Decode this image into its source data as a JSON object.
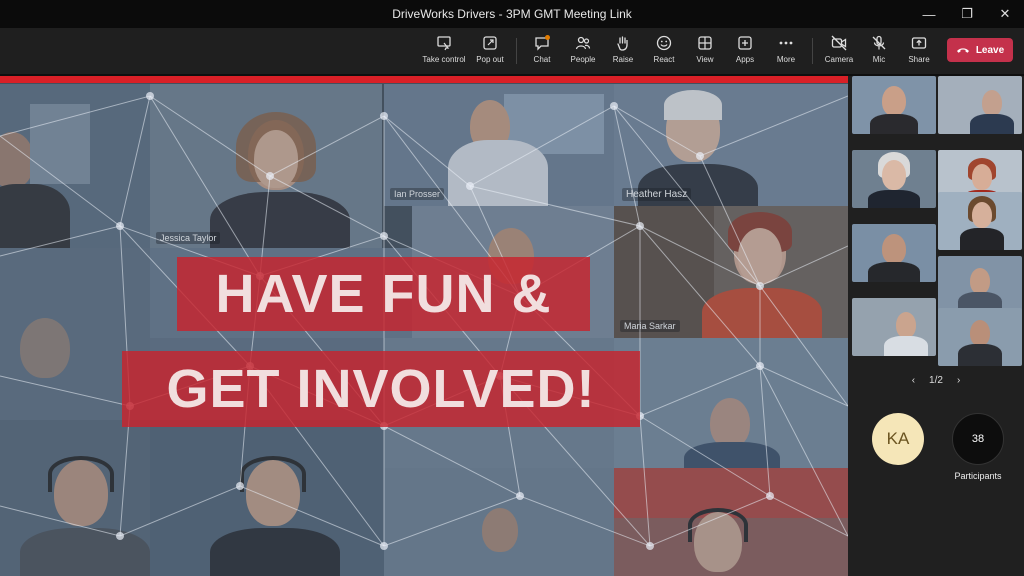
{
  "window": {
    "title": "DriveWorks Drivers - 3PM GMT Meeting Link",
    "controls": [
      "minimize-icon",
      "restore-icon",
      "close-icon"
    ]
  },
  "toolbar": {
    "items": [
      {
        "label": "Take control",
        "icon": "take-control-icon"
      },
      {
        "label": "Pop out",
        "icon": "pop-out-icon"
      },
      {
        "label": "Chat",
        "icon": "chat-icon"
      },
      {
        "label": "People",
        "icon": "people-icon"
      },
      {
        "label": "Raise",
        "icon": "raise-hand-icon"
      },
      {
        "label": "React",
        "icon": "react-icon"
      },
      {
        "label": "View",
        "icon": "view-icon"
      },
      {
        "label": "Apps",
        "icon": "apps-icon"
      },
      {
        "label": "More",
        "icon": "more-icon"
      },
      {
        "label": "Camera",
        "icon": "camera-off-icon"
      },
      {
        "label": "Mic",
        "icon": "mic-off-icon"
      },
      {
        "label": "Share",
        "icon": "share-icon"
      }
    ],
    "leave_label": "Leave",
    "chat_badge_color": "#e07b00"
  },
  "stage": {
    "banner_line1": "HAVE FUN &",
    "banner_line2": "GET INVOLVED!",
    "names": {
      "jessica": "Jessica Taylor",
      "ian": "Ian Prosser",
      "heather": "Heather Hasz",
      "maria": "Maria Sarkar"
    },
    "accent_color": "#d92027"
  },
  "side": {
    "pager": "1/2",
    "avatar_initials": "KA",
    "participant_count": "38",
    "participants_label": "Participants"
  }
}
